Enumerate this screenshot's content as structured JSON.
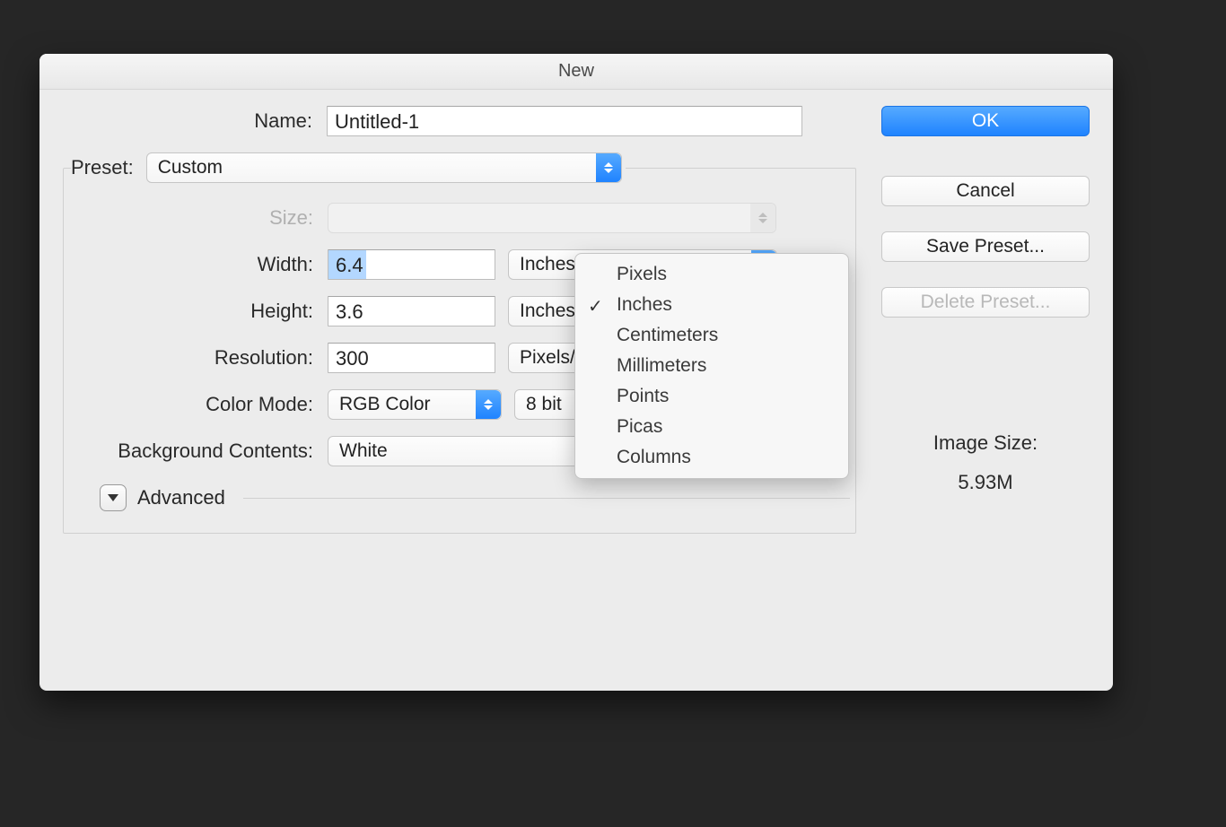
{
  "dialog": {
    "title": "New"
  },
  "name": {
    "label": "Name:",
    "value": "Untitled-1"
  },
  "preset": {
    "label": "Preset:",
    "value": "Custom"
  },
  "size": {
    "label": "Size:",
    "value": ""
  },
  "width": {
    "label": "Width:",
    "value": "6.4",
    "unit": "Inches"
  },
  "height": {
    "label": "Height:",
    "value": "3.6",
    "unit": "Inches"
  },
  "resolution": {
    "label": "Resolution:",
    "value": "300",
    "unit": "Pixels/Inch"
  },
  "colorMode": {
    "label": "Color Mode:",
    "value": "RGB Color",
    "depth": "8 bit"
  },
  "background": {
    "label": "Background Contents:",
    "value": "White"
  },
  "advanced": {
    "label": "Advanced"
  },
  "buttons": {
    "ok": "OK",
    "cancel": "Cancel",
    "savePreset": "Save Preset...",
    "deletePreset": "Delete Preset..."
  },
  "imageSize": {
    "label": "Image Size:",
    "value": "5.93M"
  },
  "unitMenu": {
    "options": [
      "Pixels",
      "Inches",
      "Centimeters",
      "Millimeters",
      "Points",
      "Picas",
      "Columns"
    ],
    "selected": "Inches"
  }
}
